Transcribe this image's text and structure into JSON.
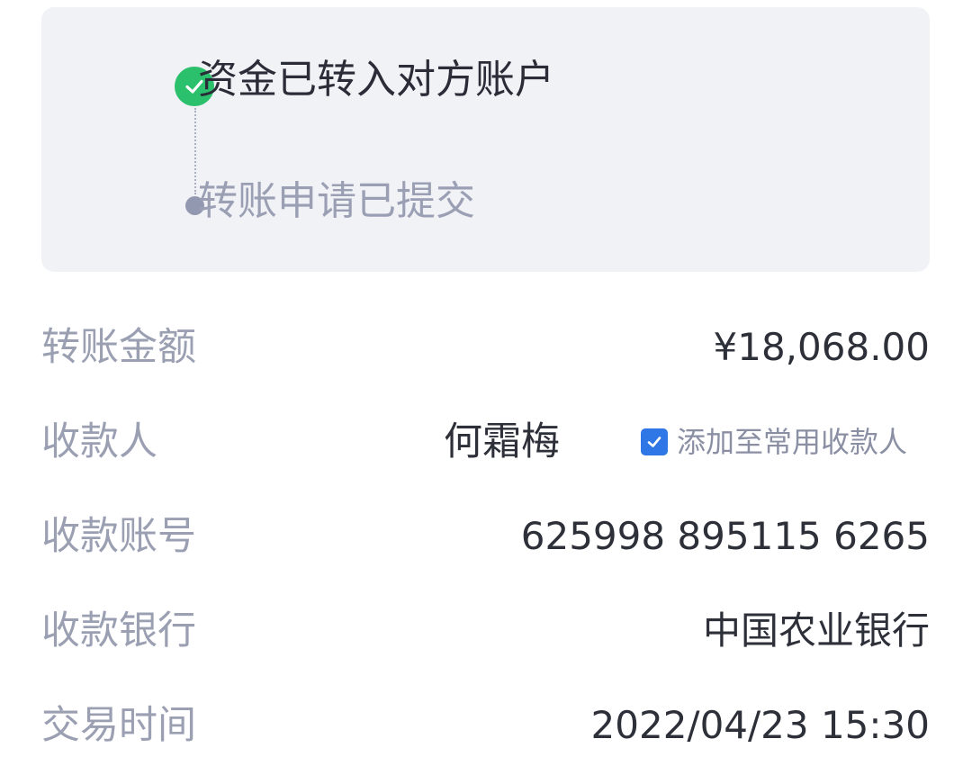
{
  "status": {
    "steps": [
      {
        "label": "资金已转入对方账户",
        "state": "done",
        "icon": "check-circle-icon"
      },
      {
        "label": "转账申请已提交",
        "state": "pending",
        "icon": "dot-icon"
      }
    ]
  },
  "details": {
    "amount": {
      "label": "转账金额",
      "value": "¥18,068.00"
    },
    "payee": {
      "label": "收款人",
      "name": "何霜梅",
      "add_to_frequent": {
        "label": "添加至常用收款人",
        "checked": true
      }
    },
    "account": {
      "label": "收款账号",
      "value": "625998 895115 6265"
    },
    "bank": {
      "label": "收款银行",
      "value": "中国农业银行"
    },
    "time": {
      "label": "交易时间",
      "value": "2022/04/23 15:30"
    }
  },
  "colors": {
    "success": "#2bc06b",
    "checkbox_accent": "#2f76e6",
    "card_background": "#f1f2f6"
  }
}
